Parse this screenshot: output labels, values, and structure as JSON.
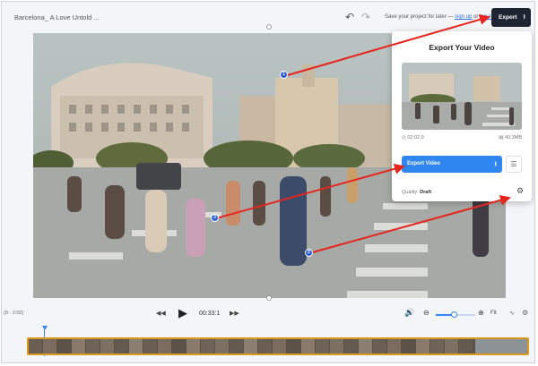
{
  "header": {
    "project_title": "Barcelona_ A Love Untold ...",
    "save_prefix": "Save your project for later — ",
    "signup_link": "sign up",
    "save_or": " or ",
    "login_link": "log in",
    "export_label": "Export",
    "undo_icon": "undo-icon",
    "redo_icon": "redo-icon"
  },
  "export_panel": {
    "title": "Export Your Video",
    "duration": "02:02.9",
    "file_size": "40.3MB",
    "export_video_label": "Export Video",
    "quality_label": "Quality:",
    "quality_value": "Draft"
  },
  "player": {
    "range": "(8 - 2:02)",
    "current_time": "00:33:1",
    "zoom_fit_label": "Fit",
    "zoom_level": 0.45
  },
  "annotations": {
    "markers": [
      "1",
      "2",
      "3"
    ]
  },
  "colors": {
    "accent": "#2f86ef",
    "export_button_bg": "#1f2530",
    "annotation_arrow": "#e5251e",
    "timeline_border": "#d99a1c"
  }
}
